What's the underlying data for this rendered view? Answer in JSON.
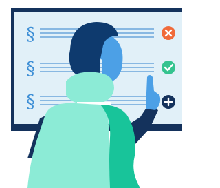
{
  "illustration": {
    "rows": [
      {
        "symbol": "§",
        "status_icon": "close-icon",
        "status_color": "#F06A3A"
      },
      {
        "symbol": "§",
        "status_icon": "check-icon",
        "status_color": "#34C38F"
      },
      {
        "symbol": "§",
        "status_icon": "plus-icon",
        "status_color": "#14325C"
      }
    ],
    "colors": {
      "frame": "#14325C",
      "screen": "#E1F0F8",
      "line": "#6AA6DA",
      "symbol": "#3E8FD6",
      "hair": "#0E3A6E",
      "face": "#4CA0E6",
      "shirt_light": "#8CEBD6",
      "shirt_dark": "#18C49A",
      "collar": "#FFFFFF"
    }
  }
}
